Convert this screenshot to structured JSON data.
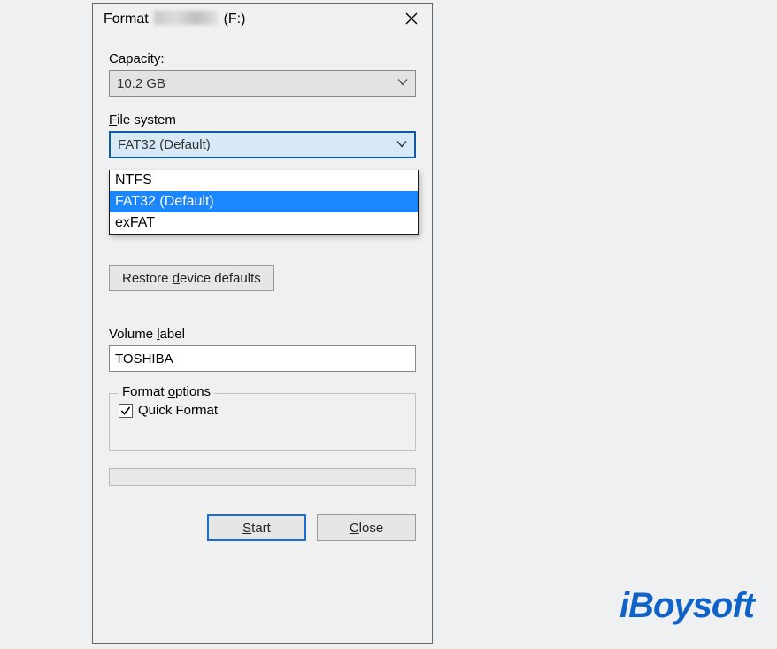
{
  "dialog": {
    "title_prefix": "Format ",
    "title_suffix": " (F:)",
    "capacity_label": "Capacity:",
    "capacity_value": "10.2 GB",
    "filesystem_label": "File system",
    "filesystem_value": "FAT32 (Default)",
    "filesystem_options": [
      {
        "label": "NTFS",
        "selected": false
      },
      {
        "label": "FAT32 (Default)",
        "selected": true
      },
      {
        "label": "exFAT",
        "selected": false
      }
    ],
    "restore_defaults": "Restore device defaults",
    "volume_label_label": "Volume label",
    "volume_label_value": "TOSHIBA",
    "format_options_legend": "Format options",
    "quick_format_label": "Quick Format",
    "quick_format_checked": true,
    "start_button": "Start",
    "close_button": "Close"
  },
  "watermark": "iBoysoft"
}
